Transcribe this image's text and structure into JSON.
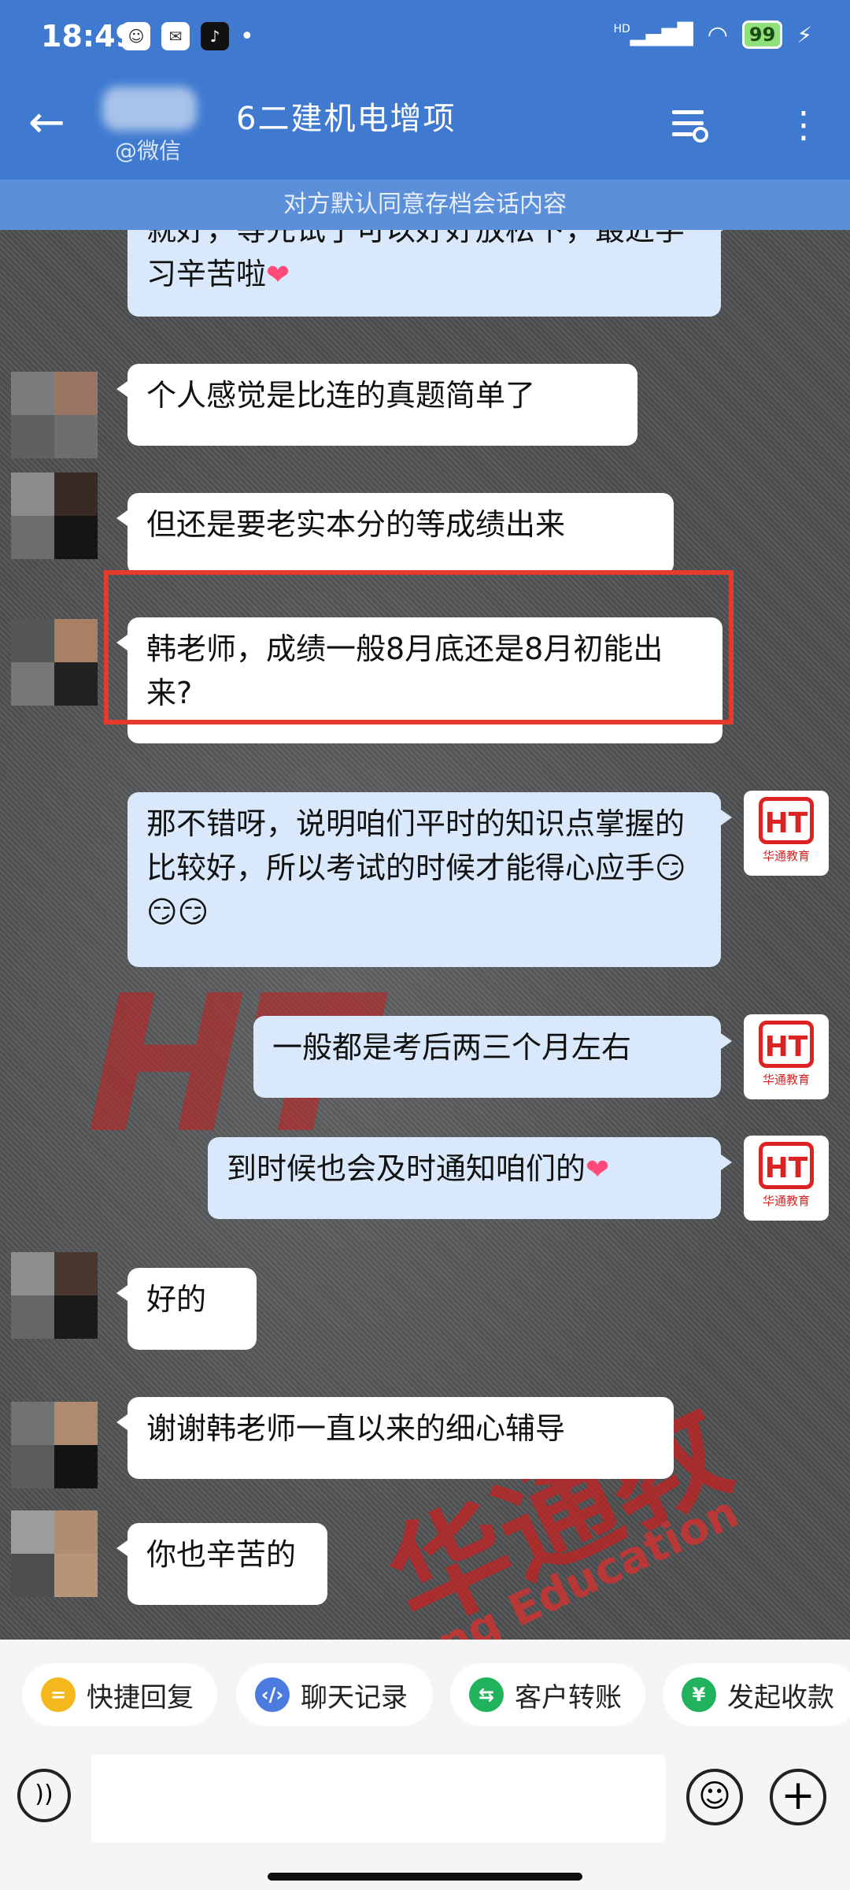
{
  "status_bar": {
    "time": "18:49",
    "battery": "99",
    "signal_label": "HD"
  },
  "header": {
    "title": "6二建机电增项",
    "sub_label": "@微信"
  },
  "notice": "对方默认同意存档会话内容",
  "messages": [
    {
      "text": "就好，等先试了可以好好放松下，最近学习辛苦啦",
      "emoji": "❤"
    },
    {
      "text": "个人感觉是比连的真题简单了"
    },
    {
      "text": "但还是要老实本分的等成绩出来"
    },
    {
      "text": "韩老师，成绩一般8月底还是8月初能出来?"
    },
    {
      "text": "那不错呀，说明咱们平时的知识点掌握的比较好，所以考试的时候才能得心应手",
      "emoji": "😏😏😏"
    },
    {
      "text": "一般都是考后两三个月左右"
    },
    {
      "text": "到时候也会及时通知咱们的",
      "emoji": "❤"
    },
    {
      "text": "好的"
    },
    {
      "text": "谢谢韩老师一直以来的细心辅导"
    },
    {
      "text": "你也辛苦的"
    }
  ],
  "teacher_avatar": {
    "logo": "HT",
    "caption": "华通教育"
  },
  "watermarks": {
    "cn": "华通教育",
    "en": "Huatong Education"
  },
  "quick_actions": [
    "快捷回复",
    "聊天记录",
    "客户转账",
    "发起收款"
  ],
  "colors": {
    "header": "#3f7ad0",
    "incoming_bubble": "#ffffff",
    "outgoing_bubble": "#d9e9fb",
    "highlight_box": "#e53a2c"
  }
}
